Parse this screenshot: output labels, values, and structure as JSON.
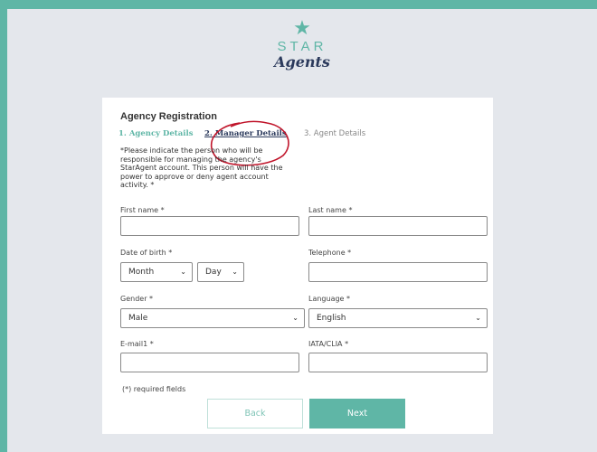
{
  "logo": {
    "star": "★",
    "word1": "STAR",
    "word2": "Agents"
  },
  "form": {
    "title": "Agency Registration",
    "steps": [
      {
        "label": "1. Agency Details"
      },
      {
        "label": "2. Manager Details"
      },
      {
        "label": "3. Agent Details"
      }
    ],
    "note": "*Please indicate the person who will be responsible for managing the agency's StarAgent account. This person will have the power to approve or deny agent account activity. *",
    "first_name_label": "First name *",
    "last_name_label": "Last name *",
    "dob_label": "Date of birth *",
    "month_value": "Month",
    "day_value": "Day",
    "telephone_label": "Telephone  *",
    "gender_label": "Gender *",
    "gender_value": "Male",
    "language_label": "Language *",
    "language_value": "English",
    "email_label": "E-mail1 *",
    "iata_label": "IATA/CLIA *",
    "required_note": "(*) required fields",
    "back_label": "Back",
    "next_label": "Next"
  },
  "colors": {
    "accent": "#5fb6a6",
    "navy": "#2b3a5c",
    "annotation": "#c0142a"
  }
}
